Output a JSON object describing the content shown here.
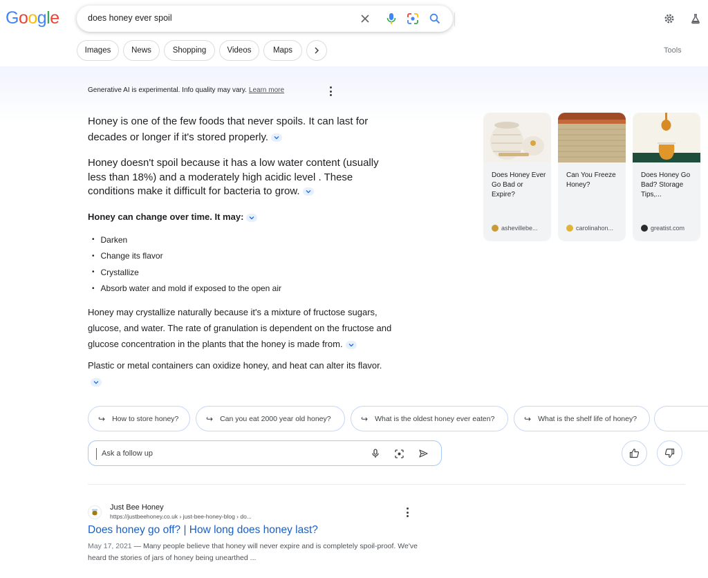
{
  "logo": [
    "G",
    "o",
    "o",
    "g",
    "l",
    "e"
  ],
  "search": {
    "query": "does honey ever spoil"
  },
  "nav_chips": [
    "Images",
    "News",
    "Shopping",
    "Videos",
    "Maps"
  ],
  "tools_label": "Tools",
  "ai_overview": {
    "disclaimer": "Generative AI is experimental. Info quality may vary.",
    "learn_more": "Learn more",
    "para1": "Honey is one of the few foods that never spoils. It can last for decades or longer if it's stored properly.",
    "para2": "Honey doesn't spoil because it has a low water content (usually less than 18%) and a moderately high acidic level . These conditions make it difficult for bacteria to grow.",
    "subheading": "Honey can change over time. It may:",
    "bullets": [
      "Darken",
      "Change its flavor",
      "Crystallize",
      "Absorb water and mold if exposed to the open air"
    ],
    "para3": "Honey may crystallize naturally because it's a mixture of fructose sugars, glucose, and water. The rate of granulation is dependent on the fructose and glucose concentration in the plants that the honey is made from.",
    "para4": "Plastic or metal containers can oxidize honey, and heat can alter its flavor.",
    "sources": [
      {
        "title": "Does Honey Ever Go Bad or Expire?",
        "site": "ashevillebe..."
      },
      {
        "title": "Can You Freeze Honey?",
        "site": "carolinahon..."
      },
      {
        "title": "Does Honey Go Bad? Storage Tips,...",
        "site": "greatist.com"
      }
    ],
    "followups": [
      "How to store honey?",
      "Can you eat 2000 year old honey?",
      "What is the oldest honey ever eaten?",
      "What is the shelf life of honey?"
    ],
    "ask_placeholder": "Ask a follow up"
  },
  "result": {
    "site_name": "Just Bee Honey",
    "url": "https://justbeehoney.co.uk › just-bee-honey-blog › do...",
    "title": "Does honey go off? | How long does honey last?",
    "date": "May 17, 2021",
    "snippet": " — Many people believe that honey will never expire and is completely spoil-proof. We've heard the stories of jars of honey being unearthed ..."
  }
}
